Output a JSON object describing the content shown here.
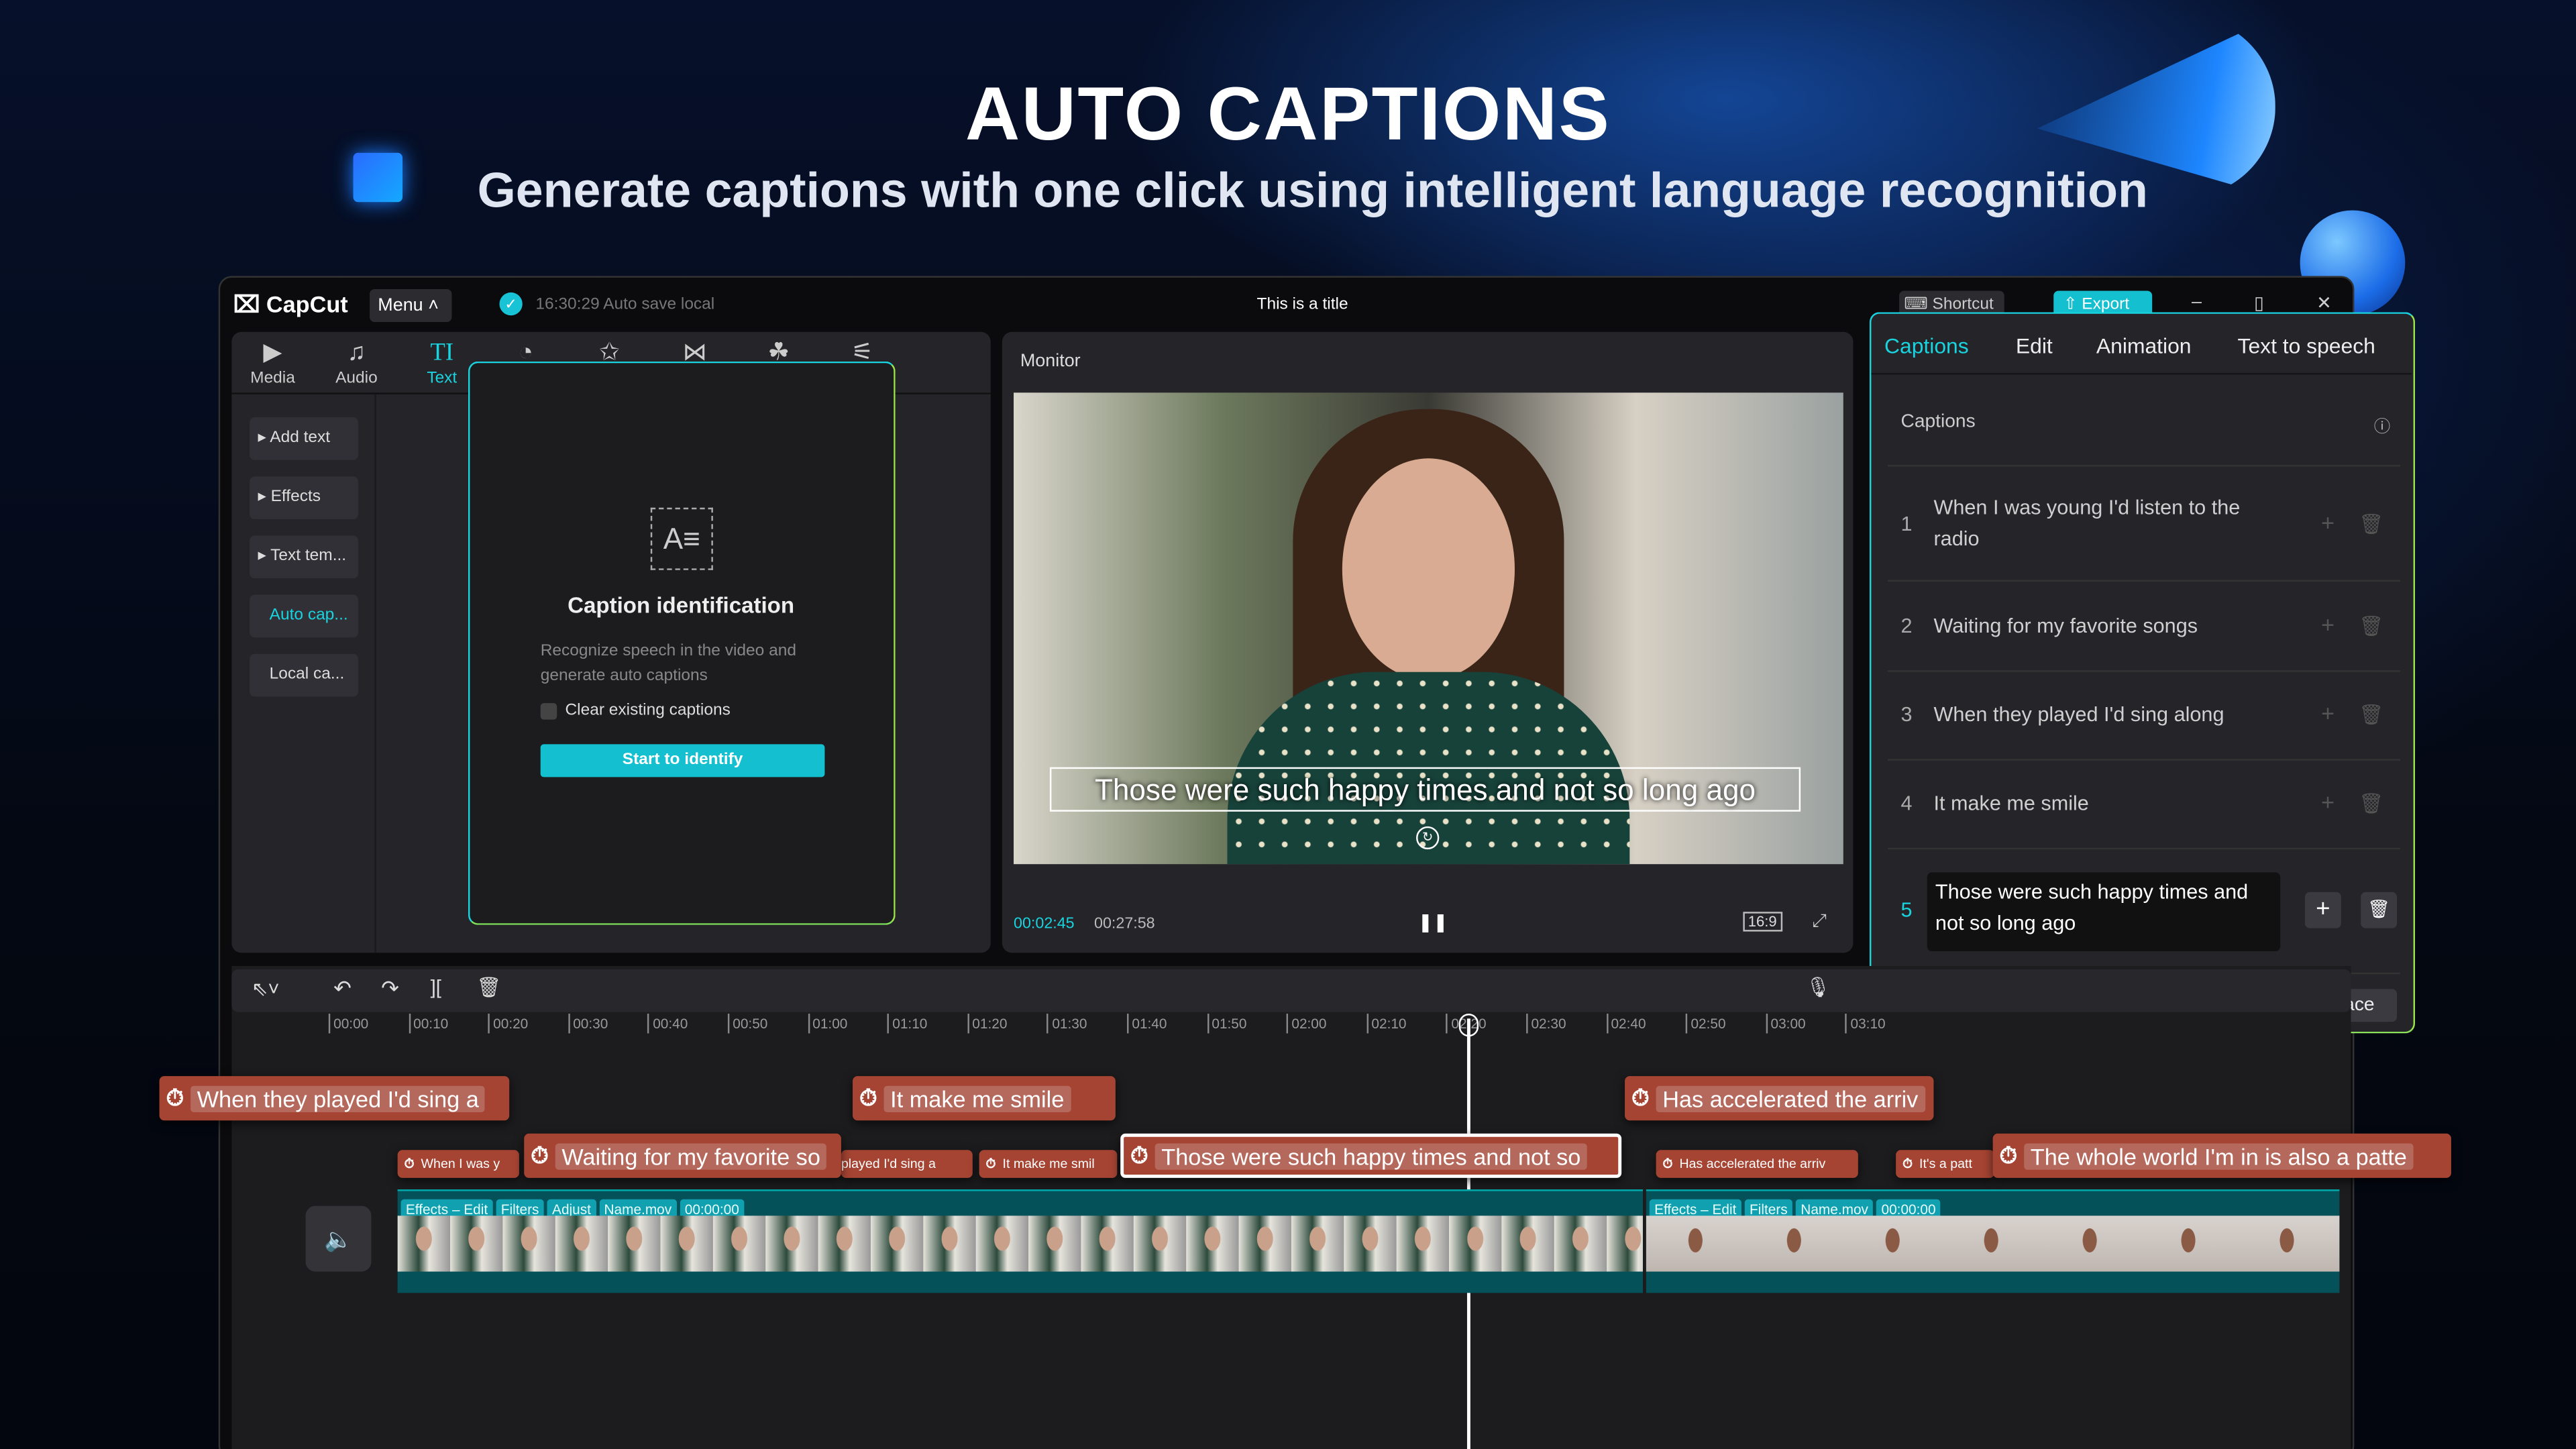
{
  "hero": {
    "title": "AUTO CAPTIONS",
    "subtitle": "Generate captions with one click using intelligent language recognition"
  },
  "titlebar": {
    "app_name": "CapCut",
    "menu_label": "Menu",
    "autosave": "16:30:29 Auto save local",
    "project_title": "This is a title",
    "shortcut_label": "Shortcut",
    "export_label": "Export",
    "minimize": "–",
    "maximize": "▯",
    "close": "✕"
  },
  "toolbar_tabs": [
    {
      "label": "Media",
      "icon": "media-icon",
      "glyph": "▶"
    },
    {
      "label": "Audio",
      "icon": "audio-icon",
      "glyph": "♫"
    },
    {
      "label": "Text",
      "icon": "text-icon",
      "glyph": "TI",
      "active": true
    },
    {
      "label": "",
      "icon": "sticker-icon",
      "glyph": "◔"
    },
    {
      "label": "",
      "icon": "effects-icon",
      "glyph": "✩"
    },
    {
      "label": "",
      "icon": "transitions-icon",
      "glyph": "⋈"
    },
    {
      "label": "",
      "icon": "filters-icon",
      "glyph": "☘"
    },
    {
      "label": "",
      "icon": "adjust-icon",
      "glyph": "⚟"
    }
  ],
  "sidebar": {
    "items": [
      {
        "label": "▸ Add text"
      },
      {
        "label": "▸ Effects"
      },
      {
        "label": "▸ Text tem..."
      },
      {
        "label": "Auto cap...",
        "active": true
      },
      {
        "label": "Local ca..."
      }
    ]
  },
  "caption_panel": {
    "title": "Caption identification",
    "description": "Recognize speech in the video and generate auto captions",
    "checkbox_label": "Clear existing captions",
    "checkbox_checked": false,
    "button_label": "Start to identify"
  },
  "monitor": {
    "title": "Monitor",
    "subtitle_text": "Those were such happy times and not so long ago",
    "current_time": "00:02:45",
    "total_time": "00:27:58",
    "aspect": "16:9"
  },
  "right_panel": {
    "tabs": [
      {
        "label": "Captions",
        "active": true
      },
      {
        "label": "Edit"
      },
      {
        "label": "Animation"
      },
      {
        "label": "Text to speech"
      }
    ],
    "section_title": "Captions",
    "captions": [
      {
        "num": "1",
        "text": "When I was young I'd listen to the radio"
      },
      {
        "num": "2",
        "text": "Waiting for my favorite songs"
      },
      {
        "num": "3",
        "text": "When they played I'd sing along"
      },
      {
        "num": "4",
        "text": "It make me smile"
      },
      {
        "num": "5",
        "text": "Those were such happy times and not so long ago",
        "editing": true
      }
    ],
    "find_replace_label": "Find & Replace"
  },
  "timeline": {
    "ruler": [
      "00:00",
      "00:10",
      "00:20",
      "00:30",
      "00:40",
      "00:50",
      "01:00",
      "01:10",
      "01:20",
      "01:30",
      "01:40",
      "01:50",
      "02:00",
      "02:10",
      "02:20",
      "02:30",
      "02:40",
      "02:50",
      "03:00",
      "03:10"
    ],
    "clips_row1": [
      "When they played I'd sing a",
      "It make me smile",
      "Has accelerated the arriv"
    ],
    "clips_row2": [
      "When I was y",
      "Waiting for my favorite so",
      "played I'd sing a",
      "It make me smil",
      "Those were such happy times and not so",
      "Has accelerated the arriv",
      "It's a patt",
      "The whole world I'm in is also a patte"
    ],
    "track1_chips": [
      "Effects – Edit",
      "Filters",
      "Adjust",
      "Name.mov",
      "00:00:00"
    ],
    "track2_chips": [
      "Effects – Edit",
      "Filters",
      "Name.mov",
      "00:00:00"
    ]
  },
  "colors": {
    "accent": "#19d3df",
    "caption_clip": "#a64433",
    "video_track": "#05515a"
  }
}
